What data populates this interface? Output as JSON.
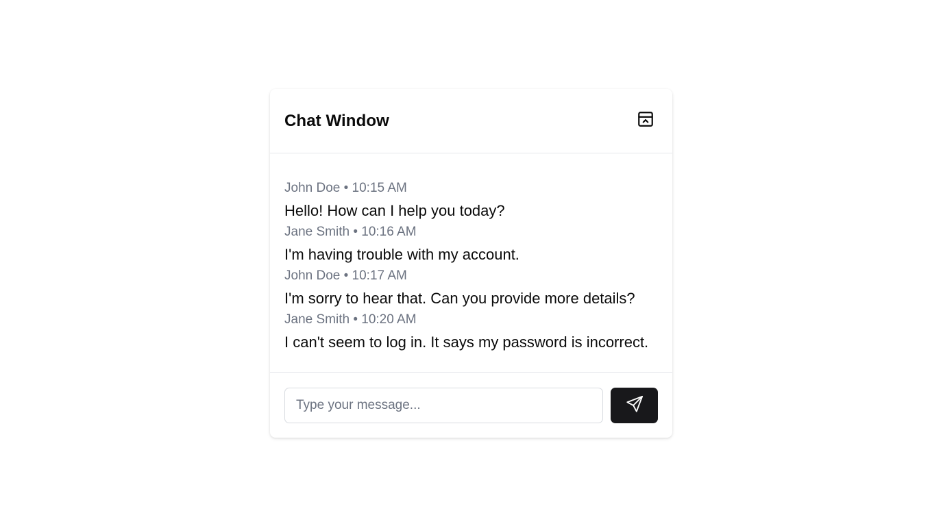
{
  "header": {
    "title": "Chat Window",
    "collapse_icon": "panel-collapse-icon"
  },
  "messages": [
    {
      "sender": "John Doe",
      "time": "10:15 AM",
      "meta": "John Doe • 10:15 AM",
      "text": "Hello! How can I help you today?"
    },
    {
      "sender": "Jane Smith",
      "time": "10:16 AM",
      "meta": "Jane Smith • 10:16 AM",
      "text": "I'm having trouble with my account."
    },
    {
      "sender": "John Doe",
      "time": "10:17 AM",
      "meta": "John Doe • 10:17 AM",
      "text": "I'm sorry to hear that. Can you provide more details?"
    },
    {
      "sender": "Jane Smith",
      "time": "10:20 AM",
      "meta": "Jane Smith • 10:20 AM",
      "text": "I can't seem to log in. It says my password is incorrect."
    }
  ],
  "composer": {
    "placeholder": "Type your message...",
    "value": "",
    "send_icon": "send-icon"
  },
  "colors": {
    "send_button_bg": "#18181b",
    "meta_text": "#6b7280",
    "border": "#e5e7eb"
  }
}
